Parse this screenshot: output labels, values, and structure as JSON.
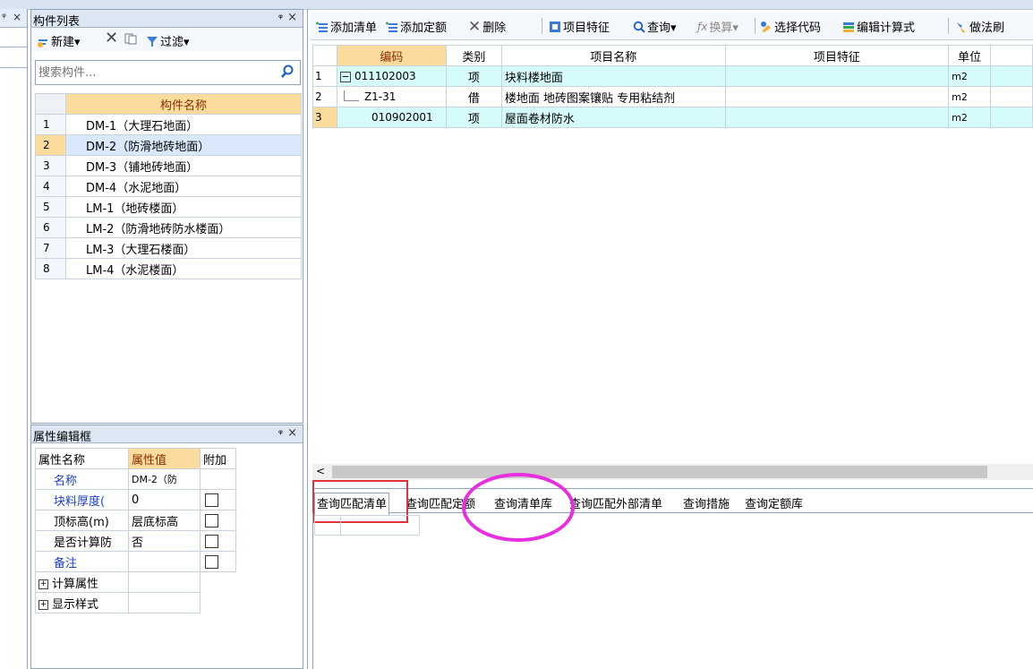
{
  "left_stub": {
    "pin": "ᵠ",
    "close": "×"
  },
  "component_panel": {
    "title": "构件列表",
    "pin": "ᵠ",
    "close": "×",
    "toolbar": {
      "new_label": "新建▾",
      "filter_label": "过滤▾"
    },
    "search_placeholder": "搜索构件...",
    "table": {
      "header": "构件名称",
      "rows": [
        {
          "num": "1",
          "name": "DM-1（大理石地面）"
        },
        {
          "num": "2",
          "name": "DM-2（防滑地砖地面）"
        },
        {
          "num": "3",
          "name": "DM-3（铺地砖地面）"
        },
        {
          "num": "4",
          "name": "DM-4（水泥地面）"
        },
        {
          "num": "5",
          "name": "LM-1（地砖楼面）"
        },
        {
          "num": "6",
          "name": "LM-2（防滑地砖防水楼面）"
        },
        {
          "num": "7",
          "name": "LM-3（大理石楼面）"
        },
        {
          "num": "8",
          "name": "LM-4（水泥楼面）"
        }
      ],
      "selected_index": 1
    }
  },
  "property_panel": {
    "title": "属性编辑框",
    "pin": "ᵠ",
    "close": "×",
    "headers": {
      "name": "属性名称",
      "value": "属性值",
      "extra": "附加"
    },
    "rows": [
      {
        "name": "名称",
        "value": "DM-2（防",
        "extra": ""
      },
      {
        "name": "块料厚度(",
        "value": "0",
        "extra": "checkbox"
      },
      {
        "name": "顶标高(m)",
        "value": "层底标高",
        "extra": "checkbox"
      },
      {
        "name": "是否计算防",
        "value": "否",
        "extra": "checkbox"
      },
      {
        "name": "备注",
        "value": "",
        "extra": "checkbox"
      }
    ],
    "groups": [
      "计算属性",
      "显示样式"
    ]
  },
  "work_toolbar": {
    "add_list": "添加清单",
    "add_quota": "添加定额",
    "delete": "删除",
    "item_feature": "项目特征",
    "query": "查询▾",
    "convert": "换算▾",
    "select_code": "选择代码",
    "edit_formula": "编辑计算式",
    "brush": "做法刷"
  },
  "list_table": {
    "headers": {
      "code": "编码",
      "type": "类别",
      "name": "项目名称",
      "feature": "项目特征",
      "unit": "单位"
    },
    "rows": [
      {
        "rn": "1",
        "code": "011102003",
        "type": "项",
        "name": "块料楼地面",
        "feature": "",
        "unit": "m2"
      },
      {
        "rn": "2",
        "code": "Z1-31",
        "type": "借",
        "name": "楼地面 地砖图案镶贴 专用粘结剂",
        "feature": "",
        "unit": "m2"
      },
      {
        "rn": "3",
        "code": "010902001",
        "type": "项",
        "name": "屋面卷材防水",
        "feature": "",
        "unit": "m2"
      }
    ],
    "tree_collapse": "−"
  },
  "bottom_tabs": [
    "查询匹配清单",
    "查询匹配定额",
    "查询清单库",
    "查询匹配外部清单",
    "查询措施",
    "查询定额库"
  ],
  "scroll_arrow": "<",
  "colors": {
    "highlight_orange": "#fbdc9c",
    "selection_blue": "#d9e8fb",
    "row_cyan": "#d6fbfb",
    "annotation_red": "#e2333a",
    "annotation_magenta": "#e72fe0"
  }
}
